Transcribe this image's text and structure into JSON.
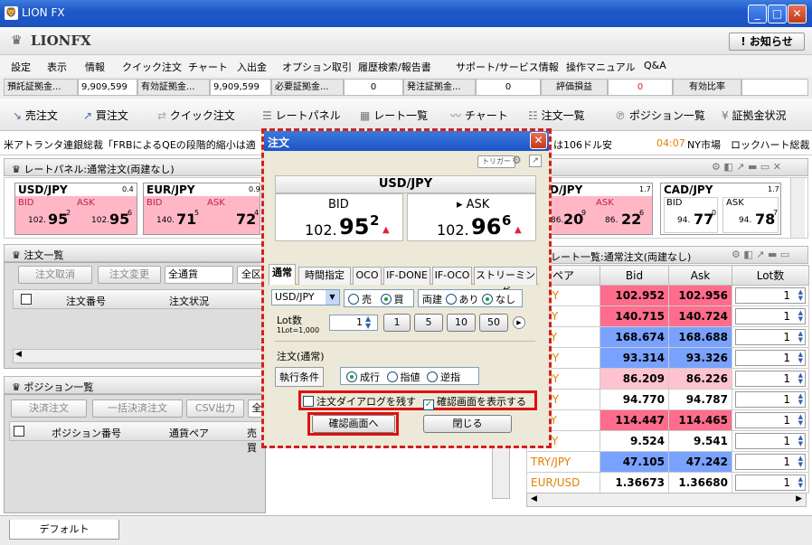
{
  "window": {
    "title": "LION FX",
    "min": "_",
    "max": "□",
    "close": "✕"
  },
  "logo": {
    "text": "LIONFX",
    "notice": "! お知らせ"
  },
  "menu": [
    "設定",
    "表示",
    "情報",
    "クイック注文",
    "チャート",
    "入出金",
    "オプション取引",
    "履歴検索/報告書",
    "サポート/サービス情報",
    "操作マニュアル",
    "Q&A"
  ],
  "status": {
    "deposit_label": "預託証拠金...",
    "deposit_value": "9,909,599",
    "valid_label": "有効証拠金...",
    "valid_value": "9,909,599",
    "required_label": "必要証拠金...",
    "required_value": "0",
    "order_label": "発注証拠金...",
    "order_value": "0",
    "pl_label": "評価損益",
    "pl_value": "0",
    "ratio_label": "有効比率"
  },
  "toolbar": [
    "売注文",
    "買注文",
    "クイック注文",
    "レートパネル",
    "レート一覧",
    "チャート",
    "注文一覧",
    "ポジション一覧",
    "証拠金状況"
  ],
  "ticker": {
    "left": "米アトランタ連銀総裁「FRBによるQEの段階的縮小は適",
    "right": "は106ドル安",
    "time": "04:07",
    "market": "NY市場",
    "tail": "ロックハート総裁"
  },
  "rate_panel": {
    "title": "レートパネル:通常注文(両建なし)",
    "pairs": [
      {
        "name": "USD/JPY",
        "spread": "0.4",
        "bid_small": "102.",
        "bid_big": "95",
        "bid_sub": "2",
        "ask_small": "102.",
        "ask_big": "95",
        "ask_sub": "6"
      },
      {
        "name": "EUR/JPY",
        "spread": "0.9",
        "bid_small": "140.",
        "bid_big": "71",
        "bid_sub": "5",
        "ask_small": "",
        "ask_big": "72",
        "ask_sub": "4"
      },
      {
        "name": "D/JPY",
        "spread": "1.7",
        "bid_small": "",
        "bid_big": "",
        "bid_sub": "",
        "ask_small": "86.",
        "ask_big": "22",
        "ask_sub": "6"
      },
      {
        "name": "CAD/JPY",
        "spread": "1.7",
        "bid_small": "94.",
        "bid_big": "77",
        "bid_sub": "0",
        "ask_small": "94.",
        "ask_big": "78",
        "ask_sub": "7"
      }
    ],
    "bid": "BID",
    "ask": "ASK",
    "left_bid_partial": "86.",
    "left_bid_partial_big": "20",
    "left_bid_partial_sub": "9"
  },
  "order_list": {
    "title": "注文一覧",
    "cancel": "注文取消",
    "modify": "注文変更",
    "filter": "全通貨",
    "filter2": "全区",
    "col_number": "注文番号",
    "col_status": "注文状況"
  },
  "position_list": {
    "title": "ポジション一覧",
    "settle": "決済注文",
    "bulk": "一括決済注文",
    "csv": "CSV出力",
    "filter": "全",
    "col_number": "ポジション番号",
    "col_pair": "通貨ペア",
    "col_trade": "売買"
  },
  "rate_list": {
    "title": "レート一覧:通常注文(両建なし)",
    "col_pair": "通貨ペア",
    "col_bid": "Bid",
    "col_ask": "Ask",
    "col_lot": "Lot数",
    "rows": [
      {
        "pair": "D/JPY",
        "bid": "102.952",
        "ask": "102.956",
        "lot": "1",
        "bid_color": "#ff6c8c",
        "ask_color": "#ff6c8c"
      },
      {
        "pair": "R/JPY",
        "bid": "140.715",
        "ask": "140.724",
        "lot": "1",
        "bid_color": "#ff6c8c",
        "ask_color": "#ff6c8c"
      },
      {
        "pair": "P/JPY",
        "bid": "168.674",
        "ask": "168.688",
        "lot": "1",
        "bid_color": "#79a2ff",
        "ask_color": "#79a2ff"
      },
      {
        "pair": "D/JPY",
        "bid": "93.314",
        "ask": "93.326",
        "lot": "1",
        "bid_color": "#79a2ff",
        "ask_color": "#79a2ff"
      },
      {
        "pair": "D/JPY",
        "bid": "86.209",
        "ask": "86.226",
        "lot": "1",
        "bid_color": "#ffc3cf",
        "ask_color": "#ffc3cf"
      },
      {
        "pair": "D/JPY",
        "bid": "94.770",
        "ask": "94.787",
        "lot": "1",
        "bid_color": "#ffffff",
        "ask_color": "#ffffff"
      },
      {
        "pair": "F/JPY",
        "bid": "114.447",
        "ask": "114.465",
        "lot": "1",
        "bid_color": "#ff6c8c",
        "ask_color": "#ff6c8c"
      },
      {
        "pair": "R/JPY",
        "bid": "9.524",
        "ask": "9.541",
        "lot": "1",
        "bid_color": "#ffffff",
        "ask_color": "#ffffff"
      },
      {
        "pair": "TRY/JPY",
        "bid": "47.105",
        "ask": "47.242",
        "lot": "1",
        "bid_color": "#79a2ff",
        "ask_color": "#79a2ff"
      },
      {
        "pair": "EUR/USD",
        "bid": "1.36673",
        "ask": "1.36680",
        "lot": "1",
        "bid_color": "#ffffff",
        "ask_color": "#ffffff"
      }
    ]
  },
  "bottom_tab": "デフォルト",
  "dialog": {
    "title": "注文",
    "trigger": "トリガー",
    "pair": "USD/JPY",
    "bid_label": "BID",
    "ask_label": "▸ ASK",
    "bid_small": "102.",
    "bid_big": "95",
    "bid_sub": "2",
    "ask_small": "102.",
    "ask_big": "96",
    "ask_sub": "6",
    "tabs": [
      "通常",
      "時間指定",
      "OCO",
      "IF-DONE",
      "IF-OCO",
      "ストリーミング"
    ],
    "pair_select": "USD/JPY",
    "sell": "売",
    "buy": "買",
    "hedge_label": "両建",
    "hedge_on": "あり",
    "hedge_off": "なし",
    "lot_label": "Lot数",
    "lot_note": "1Lot=1,000",
    "lot_value": "1",
    "presets": [
      "1",
      "5",
      "10",
      "50"
    ],
    "section": "注文(通常)",
    "exec_label": "執行条件",
    "exec_market": "成行",
    "exec_limit": "指値",
    "exec_stop": "逆指",
    "keep_dialog": "注文ダイアログを残す",
    "show_confirm": "確認画面を表示する",
    "confirm_button": "確認画面へ",
    "close_button": "閉じる"
  }
}
